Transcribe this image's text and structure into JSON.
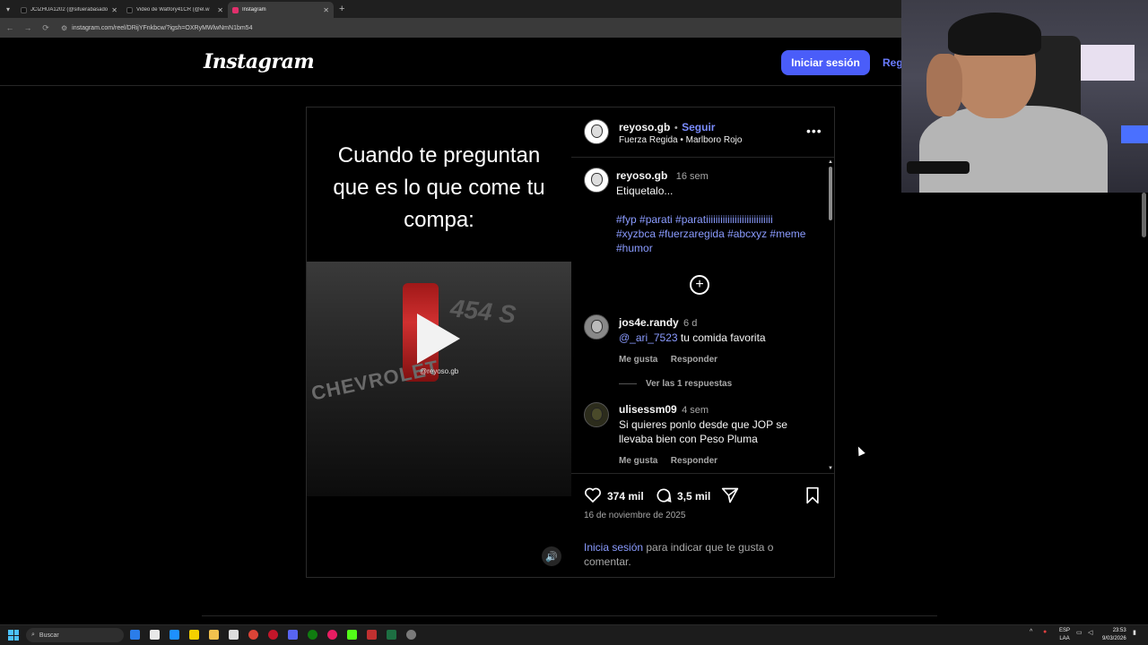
{
  "browser": {
    "tabs": [
      {
        "title": "JCIZHUA1202 (@sifuerabasado",
        "color": "#111111",
        "active": false
      },
      {
        "title": "Video de Watfory41CR (@el.w",
        "color": "#111111",
        "active": false
      },
      {
        "title": "Instagram",
        "color": "#e1306c",
        "active": true
      }
    ],
    "new_tab": "+",
    "url": "instagram.com/reel/DRijYFnkbcw/?igsh=OXRyMWlwNmN1bm54"
  },
  "header": {
    "logo": "Instagram",
    "login_label": "Iniciar sesión",
    "register_label": "Reg"
  },
  "post": {
    "overlay_caption": [
      "Cuando te preguntan",
      "que es lo que come tu",
      "compa:"
    ],
    "video": {
      "plate_text": "454 S",
      "brand_text": "CHEVROLET",
      "watermark": "@reyoso.gb"
    },
    "author": {
      "username": "reyoso.gb",
      "follow_label": "Seguir",
      "separator": "•",
      "audio": "Fuerza Regida • Marlboro Rojo"
    },
    "caption": {
      "username": "reyoso.gb",
      "time": "16 sem",
      "text": "Etiquetalo...",
      "hashtags_line1": "#fyp #parati #paratiiiiiiiiiiiiiiiiiiiiiiiiiiii",
      "hashtags_line2": "#xyzbca #fuerzaregida #abcxyz #meme",
      "hashtags_line3": "#humor"
    },
    "comments": [
      {
        "username": "jos4e.randy",
        "time": "6 d",
        "mention": "@_ari_7523",
        "text": " tu comida favorita",
        "like_label": "Me gusta",
        "reply_label": "Responder",
        "replies_label": "Ver las 1 respuestas"
      },
      {
        "username": "ulisessm09",
        "time": "4 sem",
        "text_line1": "Si quieres ponlo desde que JOP se",
        "text_line2": "llevaba bien con Peso Pluma",
        "like_label": "Me gusta",
        "reply_label": "Responder"
      }
    ],
    "likes": "374 mil",
    "comments_count": "3,5 mil",
    "date": "16 de noviembre de 2025",
    "login_prompt": {
      "link": "Inicia sesión",
      "text": " para indicar que te gusta o comentar."
    }
  },
  "taskbar": {
    "search_placeholder": "Buscar",
    "lang_top": "ESP",
    "lang_bottom": "LAA",
    "time": "23:53",
    "date": "9/03/2026"
  },
  "colors": {
    "accent": "#4a5df9",
    "link": "#8a9bff",
    "background": "#000000"
  }
}
